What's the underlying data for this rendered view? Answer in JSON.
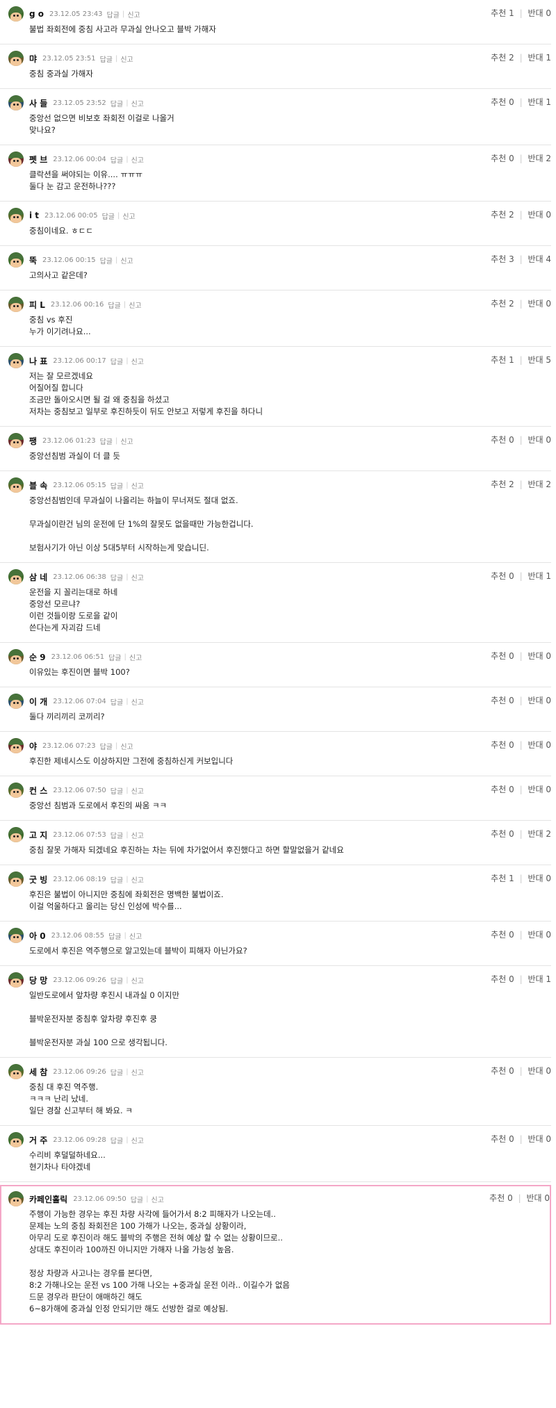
{
  "labels": {
    "reply": "답글",
    "report": "신고",
    "up": "추천",
    "down": "반대"
  },
  "comments": [
    {
      "nick": "g o",
      "date": "23.12.05 23:43",
      "up": "1",
      "down": "0",
      "lines": [
        "불법 좌회전에 중침 사고라 무과실 안나오고 블박 가해자"
      ]
    },
    {
      "nick": "먀",
      "date": "23.12.05 23:51",
      "up": "2",
      "down": "1",
      "lines": [
        "중침 중과실 가해자"
      ]
    },
    {
      "nick": "사 들",
      "date": "23.12.05 23:52",
      "up": "0",
      "down": "1",
      "lines": [
        "중앙선 없으면 비보호 좌회전 이걸로 나올거",
        "맞나요?"
      ]
    },
    {
      "nick": "펫 브",
      "date": "23.12.06 00:04",
      "up": "0",
      "down": "2",
      "lines": [
        "클락션을 써야되는 이유.... ㅠㅠㅠ",
        "둘다 눈 감고 운전하나???"
      ]
    },
    {
      "nick": "i t",
      "date": "23.12.06 00:05",
      "up": "2",
      "down": "0",
      "lines": [
        "중침이네요. ㅎㄷㄷ"
      ]
    },
    {
      "nick": "뚝",
      "date": "23.12.06 00:15",
      "up": "3",
      "down": "4",
      "lines": [
        "고의사고 같은데?"
      ]
    },
    {
      "nick": "피 L",
      "date": "23.12.06 00:16",
      "up": "2",
      "down": "0",
      "lines": [
        "중침 vs 후진",
        "누가 이기려나요..."
      ]
    },
    {
      "nick": "나 표",
      "date": "23.12.06 00:17",
      "up": "1",
      "down": "5",
      "lines": [
        "저는 잘 모르겠네요",
        "어질어질 합니다",
        "조금만 돌아오시면 될 걸 왜 중침을 하셨고",
        "저차는 중침보고 일부로 후진하듯이 뒤도 안보고 저렇게 후진을 하다니"
      ]
    },
    {
      "nick": "팽",
      "date": "23.12.06 01:23",
      "up": "0",
      "down": "0",
      "lines": [
        "중앙선침범 과실이 더 클 듯"
      ]
    },
    {
      "nick": "블 속",
      "date": "23.12.06 05:15",
      "up": "2",
      "down": "2",
      "lines": [
        "중앙선침범인데 무과실이 나올리는 하늘이 무너져도 절대 없죠.",
        "",
        "무과실이란건 님의 운전에 단 1%의 잘못도 없을때만 가능한겁니다.",
        "",
        "보험사기가 아닌 이상 5대5부터 시작하는게 맞습니딘."
      ]
    },
    {
      "nick": "삼 네",
      "date": "23.12.06 06:38",
      "up": "0",
      "down": "1",
      "lines": [
        "운전을 지 꼴리는대로 하네",
        "중앙선 모르냐?",
        "이런 것들이랑 도로을 같이",
        "쓴다는게 자괴감 드네"
      ]
    },
    {
      "nick": "순 9",
      "date": "23.12.06 06:51",
      "up": "0",
      "down": "0",
      "lines": [
        "이유있는 후진이면 블박 100?"
      ]
    },
    {
      "nick": "이 개",
      "date": "23.12.06 07:04",
      "up": "0",
      "down": "0",
      "lines": [
        "둘다 끼리끼리 코끼리?"
      ]
    },
    {
      "nick": "야",
      "date": "23.12.06 07:23",
      "up": "0",
      "down": "0",
      "lines": [
        "후진한 제네시스도 이상하지만 그전에 중침하신게 커보입니다"
      ]
    },
    {
      "nick": "컨 스",
      "date": "23.12.06 07:50",
      "up": "0",
      "down": "0",
      "lines": [
        "중앙선 침범과 도로에서 후진의 싸움 ㅋㅋ"
      ]
    },
    {
      "nick": "고 지",
      "date": "23.12.06 07:53",
      "up": "0",
      "down": "2",
      "lines": [
        "중침 잘못 가해자 되겠네요 후진하는 차는 뒤에 차가없어서 후진했다고 하면 할말없을거 같네요"
      ]
    },
    {
      "nick": "굿 빙",
      "date": "23.12.06 08:19",
      "up": "1",
      "down": "0",
      "lines": [
        "후진은 불법이 아니지만 중침에 좌회전은 명백한 불법이죠.",
        "이걸 억울하다고 올리는 당신 인성에 박수를..."
      ]
    },
    {
      "nick": "아 0",
      "date": "23.12.06 08:55",
      "up": "0",
      "down": "0",
      "lines": [
        "도로에서 후진은 역주행으로 알고있는데 블박이 피해자 아닌가요?"
      ]
    },
    {
      "nick": "당 망",
      "date": "23.12.06 09:26",
      "up": "0",
      "down": "1",
      "lines": [
        "일반도로에서 앞차량 후진시 내과실 0 이지만",
        "",
        "블박운전자분 중침후 앞차량 후진후 쿵",
        "",
        "블박운전자분 과실 100 으로 생각됩니다."
      ]
    },
    {
      "nick": "세 참",
      "date": "23.12.06 09:26",
      "up": "0",
      "down": "0",
      "lines": [
        "중침 대 후진 역주행.",
        "ㅋㅋㅋ 난리 났네.",
        "일단 경찰 신고부터 해 봐요. ㅋ"
      ]
    },
    {
      "nick": "거 주",
      "date": "23.12.06 09:28",
      "up": "0",
      "down": "0",
      "lines": [
        "수리비 후덜덜하네요...",
        "현기차나 타야겠네"
      ]
    },
    {
      "nick": "카페인홀릭",
      "date": "23.12.06 09:50",
      "up": "0",
      "down": "0",
      "highlight": true,
      "lines": [
        "주행이 가능한 경우는 후진 차량 사각에 들어가서 8:2 피해자가 나오는데..",
        "문제는 노의 중침 좌회전은 100 가해가 나오는, 중과실 상황이라,",
        "아무리 도로 후진이라 해도 블박의 주행은 전혀 예상 할 수 없는 상황이므로..",
        "상대도 후진이라 100까진 아니지만 가해자 나올 가능성 높음.",
        "",
        "정상 차량과 사고나는 경우를 본다면,",
        "8:2 가해나오는 운전 vs 100 가해 나오는 +중과실 운전 이라.. 이길수가 없음",
        "드문 경우라 판단이 애매하긴 해도",
        "6~8가해에 중과실 인정 안되기만 해도 선방한 걸로 예상됨."
      ]
    }
  ]
}
